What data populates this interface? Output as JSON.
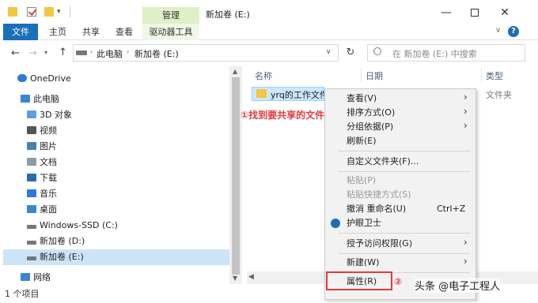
{
  "window": {
    "title": "新加卷 (E:)",
    "manage_tab": "管理",
    "quick_access_dropdown": "▾",
    "min": "—",
    "close": "✕"
  },
  "ribbon": {
    "tabs": [
      "文件",
      "主页",
      "共享",
      "查看",
      "驱动器工具"
    ],
    "expand": "∨",
    "help": "?"
  },
  "address": {
    "back": "←",
    "forward": "→",
    "recent": "▾",
    "up": "↑",
    "sep": "›",
    "crumbs": [
      "此电脑",
      "新加卷 (E:)"
    ],
    "dropdown": "∨",
    "refresh": "↻",
    "search_placeholder": "在 新加卷 (E:) 中搜索"
  },
  "sidebar": {
    "items": [
      "OneDrive",
      "此电脑",
      "3D 对象",
      "视频",
      "图片",
      "文档",
      "下载",
      "音乐",
      "桌面",
      "Windows-SSD (C:)",
      "新加卷 (D:)",
      "新加卷 (E:)",
      "网络"
    ],
    "scroll_up": "▲",
    "scroll_down": "▼"
  },
  "filelist": {
    "columns": [
      "名称",
      "日期",
      "类型"
    ],
    "files": [
      {
        "name": "yrq的工作文件",
        "type": "文件夹"
      }
    ],
    "hscroll_left": "◀"
  },
  "status": {
    "text": "1 个项目"
  },
  "context_menu": {
    "items": [
      {
        "label": "查看(V)",
        "submenu": true
      },
      {
        "label": "排序方式(O)",
        "submenu": true
      },
      {
        "label": "分组依据(P)",
        "submenu": true
      },
      {
        "label": "刷新(E)"
      },
      {
        "label": "自定义文件夹(F)..."
      },
      {
        "label": "粘贴(P)",
        "disabled": true
      },
      {
        "label": "粘贴快捷方式(S)",
        "disabled": true
      },
      {
        "label": "撤消 重命名(U)",
        "shortcut": "Ctrl+Z"
      },
      {
        "label": "护眼卫士"
      },
      {
        "label": "授予访问权限(G)",
        "submenu": true
      },
      {
        "label": "新建(W)",
        "submenu": true
      },
      {
        "label": "属性(R)"
      }
    ],
    "arrow": "›"
  },
  "annotations": {
    "step1": "①找到要共享的文件",
    "step2": "②",
    "watermark": "头条 @电子工程人"
  },
  "colors": {
    "accent": "#1a6fb8",
    "annotation": "#e23b3b",
    "selection": "#cce4f7",
    "folder": "#f4c542",
    "manage_tab": "#dff0c8"
  }
}
